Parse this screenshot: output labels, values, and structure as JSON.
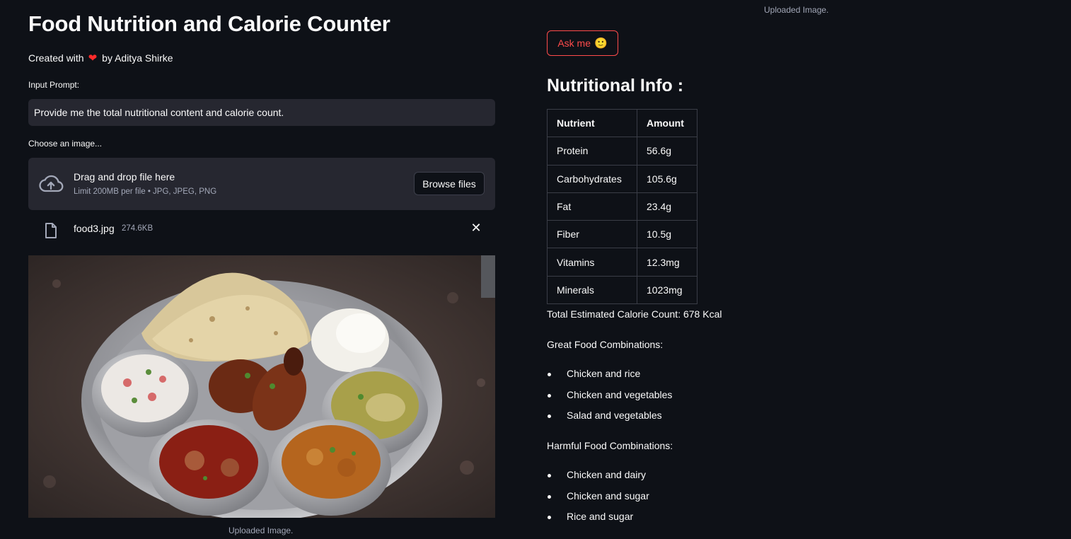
{
  "app": {
    "title": "Food Nutrition and Calorie Counter",
    "credit_prefix": "Created with",
    "credit_heart": "❤",
    "credit_suffix": "by Aditya Shirke"
  },
  "prompt": {
    "label": "Input Prompt:",
    "value": "Provide me the total nutritional content and calorie count."
  },
  "uploader": {
    "label": "Choose an image...",
    "drop_text": "Drag and drop file here",
    "limit_text": "Limit 200MB per file • JPG, JPEG, PNG",
    "browse_label": "Browse files",
    "file_name": "food3.jpg",
    "file_size": "274.6KB",
    "remove_icon": "✕"
  },
  "image_captions": {
    "left": "Uploaded Image.",
    "top_right": "Uploaded Image."
  },
  "ask_button": {
    "label": "Ask me",
    "emoji": "🙂"
  },
  "nutrition": {
    "heading": "Nutritional Info :",
    "headers": [
      "Nutrient",
      "Amount"
    ],
    "rows": [
      {
        "nutrient": "Protein",
        "amount": "56.6g"
      },
      {
        "nutrient": "Carbohydrates",
        "amount": "105.6g"
      },
      {
        "nutrient": "Fat",
        "amount": "23.4g"
      },
      {
        "nutrient": "Fiber",
        "amount": "10.5g"
      },
      {
        "nutrient": "Vitamins",
        "amount": "12.3mg"
      },
      {
        "nutrient": "Minerals",
        "amount": "1023mg"
      }
    ],
    "total_calories": "Total Estimated Calorie Count: 678 Kcal"
  },
  "combinations": {
    "great_heading": "Great Food Combinations:",
    "great": [
      "Chicken and rice",
      "Chicken and vegetables",
      "Salad and vegetables"
    ],
    "harmful_heading": "Harmful Food Combinations:",
    "harmful": [
      "Chicken and dairy",
      "Chicken and sugar",
      "Rice and sugar"
    ]
  },
  "icons": {
    "upload": "cloud-upload-icon",
    "file": "file-icon",
    "close": "close-icon"
  },
  "colors": {
    "background": "#0e1117",
    "surface": "#262730",
    "accent": "#ff4b4b",
    "heart": "#ff2b2b",
    "muted_text": "#a3a8b8"
  }
}
